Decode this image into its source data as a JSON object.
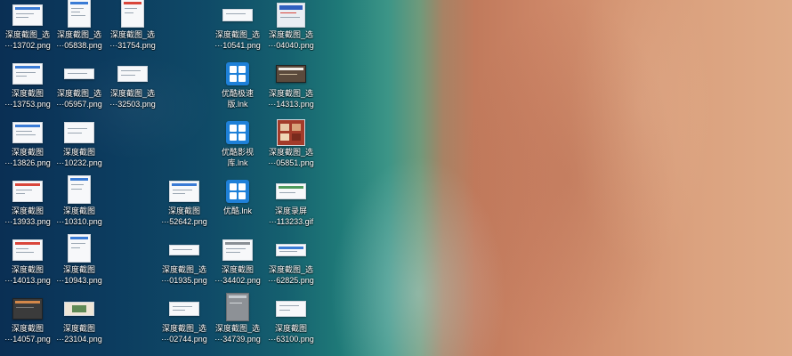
{
  "desktop": {
    "icons": [
      {
        "id": "c0r0",
        "line1": "深度截图_选",
        "line2": "···13702.png",
        "type": "screenshot"
      },
      {
        "id": "c1r0",
        "line1": "深度截图_选",
        "line2": "···05838.png",
        "type": "screenshot"
      },
      {
        "id": "c2r0",
        "line1": "深度截图_选",
        "line2": "···31754.png",
        "type": "screenshot"
      },
      {
        "id": "c4r0",
        "line1": "深度截图_选",
        "line2": "···10541.png",
        "type": "screenshot"
      },
      {
        "id": "c5r0",
        "line1": "深度截图_选",
        "line2": "···04040.png",
        "type": "screenshot"
      },
      {
        "id": "c0r1",
        "line1": "深度截图",
        "line2": "···13753.png",
        "type": "screenshot"
      },
      {
        "id": "c1r1",
        "line1": "深度截图_选",
        "line2": "···05957.png",
        "type": "screenshot"
      },
      {
        "id": "c2r1",
        "line1": "深度截图_选",
        "line2": "···32503.png",
        "type": "screenshot"
      },
      {
        "id": "c4r1",
        "line1": "优酷极速",
        "line2": "版.lnk",
        "type": "shortcut"
      },
      {
        "id": "c5r1",
        "line1": "深度截图_选",
        "line2": "···14313.png",
        "type": "screenshot"
      },
      {
        "id": "c0r2",
        "line1": "深度截图",
        "line2": "···13826.png",
        "type": "screenshot"
      },
      {
        "id": "c1r2",
        "line1": "深度截图",
        "line2": "···10232.png",
        "type": "screenshot"
      },
      {
        "id": "c4r2",
        "line1": "优酷影视",
        "line2": "库.lnk",
        "type": "shortcut"
      },
      {
        "id": "c5r2",
        "line1": "深度截图_选",
        "line2": "···05851.png",
        "type": "screenshot"
      },
      {
        "id": "c0r3",
        "line1": "深度截图",
        "line2": "···13933.png",
        "type": "screenshot"
      },
      {
        "id": "c1r3",
        "line1": "深度截图",
        "line2": "···10310.png",
        "type": "screenshot"
      },
      {
        "id": "c3r3",
        "line1": "深度截图",
        "line2": "···52642.png",
        "type": "screenshot"
      },
      {
        "id": "c4r3",
        "line1": "优酷.lnk",
        "line2": "",
        "type": "shortcut"
      },
      {
        "id": "c5r3",
        "line1": "深度录屏",
        "line2": "···113233.gif",
        "type": "screenshot"
      },
      {
        "id": "c0r4",
        "line1": "深度截图",
        "line2": "···14013.png",
        "type": "screenshot"
      },
      {
        "id": "c1r4",
        "line1": "深度截图",
        "line2": "···10943.png",
        "type": "screenshot"
      },
      {
        "id": "c3r4",
        "line1": "深度截图_选",
        "line2": "···01935.png",
        "type": "screenshot"
      },
      {
        "id": "c4r4",
        "line1": "深度截图",
        "line2": "···34402.png",
        "type": "screenshot"
      },
      {
        "id": "c5r4",
        "line1": "深度截图_选",
        "line2": "···62825.png",
        "type": "screenshot"
      },
      {
        "id": "c0r5",
        "line1": "深度截图",
        "line2": "···14057.png",
        "type": "screenshot"
      },
      {
        "id": "c1r5",
        "line1": "深度截图",
        "line2": "···23104.png",
        "type": "screenshot"
      },
      {
        "id": "c3r5",
        "line1": "深度截图_选",
        "line2": "···02744.png",
        "type": "screenshot"
      },
      {
        "id": "c4r5",
        "line1": "深度截图_选",
        "line2": "···34739.png",
        "type": "screenshot"
      },
      {
        "id": "c5r5",
        "line1": "深度截图",
        "line2": "···63100.png",
        "type": "screenshot"
      }
    ]
  }
}
